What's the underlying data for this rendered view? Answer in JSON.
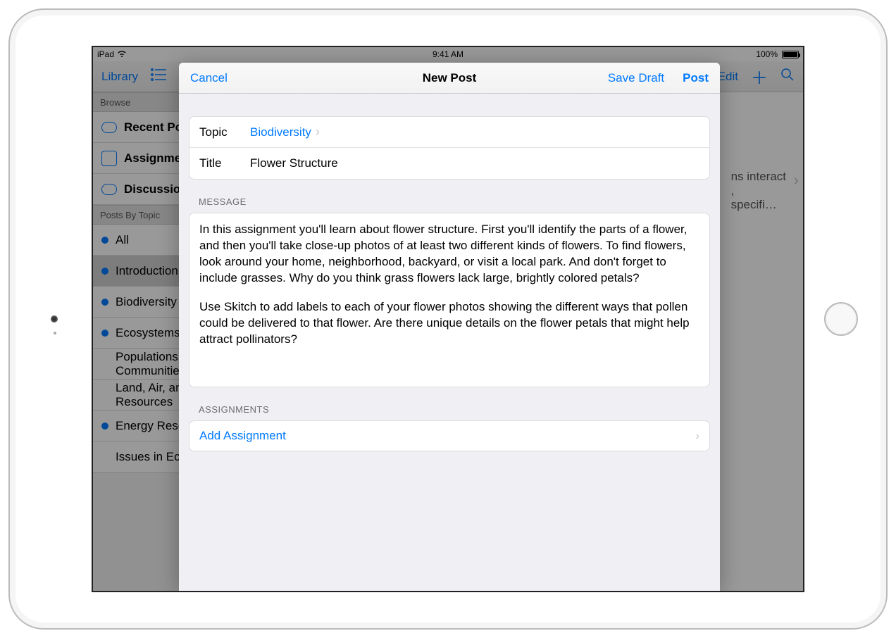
{
  "status": {
    "device": "iPad",
    "time": "9:41 AM",
    "battery": "100%"
  },
  "bg_toolbar": {
    "library": "Library",
    "edit": "Edit"
  },
  "sidebar": {
    "browse_header": "Browse",
    "recent": "Recent Posts",
    "assignments": "Assignments",
    "discussions": "Discussions",
    "posts_by_topic_header": "Posts By Topic",
    "topics": [
      "All",
      "Introduction",
      "Biodiversity",
      "Ecosystems",
      "Populations and Communities",
      "Land, Air, and Water Resources",
      "Energy Resources",
      "Issues in Ecosystems"
    ]
  },
  "detail": {
    "line1": "interact",
    "line3": "specifi…"
  },
  "modal": {
    "cancel": "Cancel",
    "title": "New Post",
    "save_draft": "Save Draft",
    "post": "Post",
    "topic_label": "Topic",
    "topic_value": "Biodiversity",
    "title_label": "Title",
    "title_value": "Flower Structure",
    "message_header": "MESSAGE",
    "message_p1": "In this assignment you'll learn about flower structure. First you'll identify the parts of a flower, and then you'll take close-up photos of at least two different kinds of flowers. To find flowers, look around your home, neighborhood, backyard, or visit a local park. And don't forget to include grasses. Why do you think grass flowers lack large, brightly colored petals?",
    "message_p2": "Use Skitch to add labels to each of your flower photos showing the different ways that pollen could be delivered to that flower. Are there unique details on the flower petals that might help attract pollinators?",
    "assignments_header": "ASSIGNMENTS",
    "add_assignment": "Add Assignment"
  }
}
